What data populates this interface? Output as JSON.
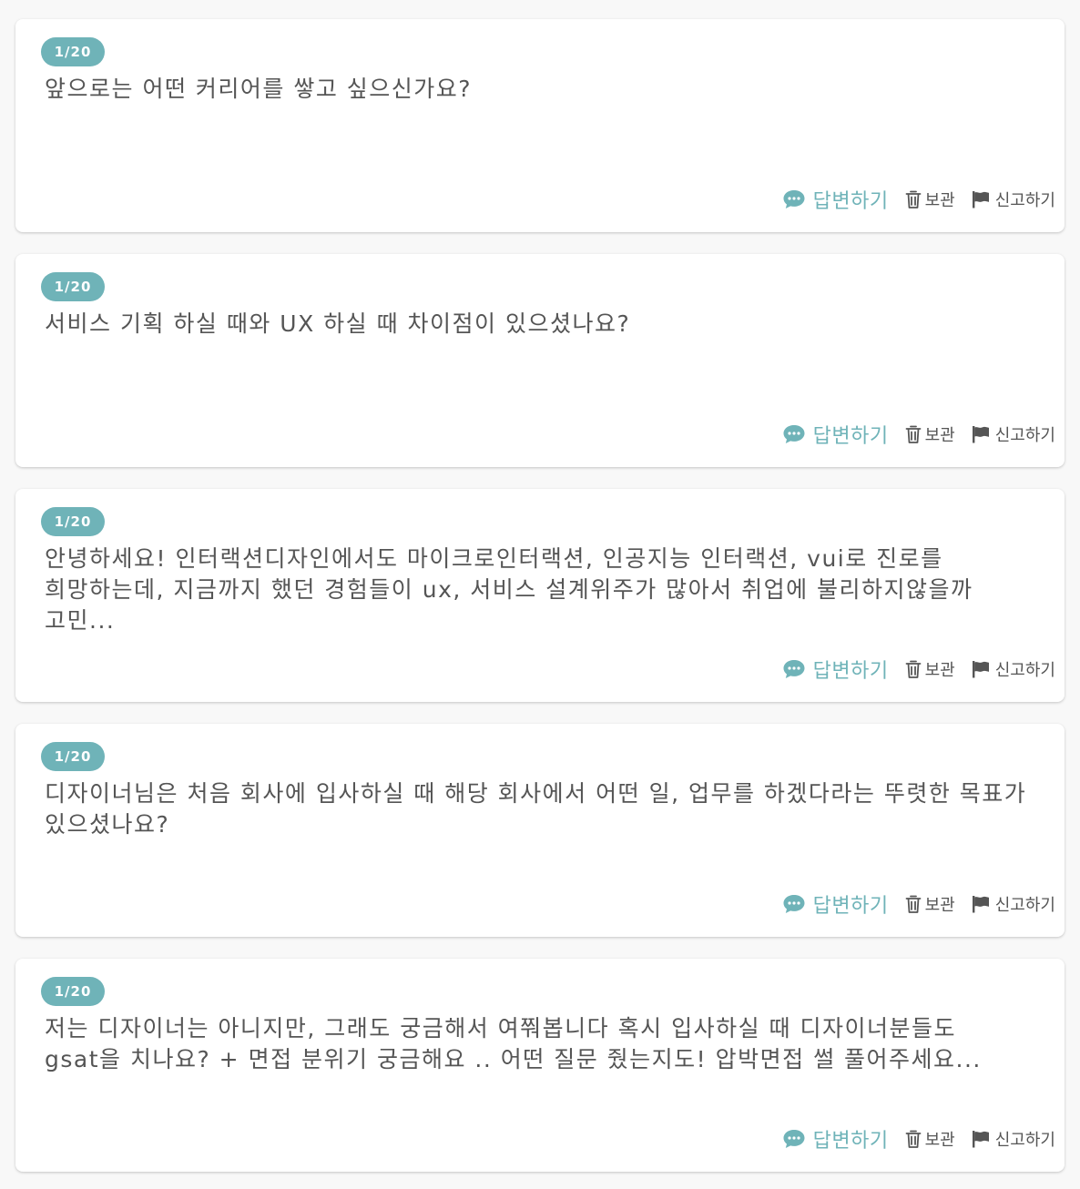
{
  "questions": [
    {
      "badge": "1/20",
      "text": "앞으로는 어떤 커리어를 쌓고 싶으신가요?",
      "actions": {
        "answer": "답변하기",
        "archive": "보관",
        "report": "신고하기"
      }
    },
    {
      "badge": "1/20",
      "text": "서비스 기획 하실 때와 UX 하실 때 차이점이 있으셨나요?",
      "actions": {
        "answer": "답변하기",
        "archive": "보관",
        "report": "신고하기"
      }
    },
    {
      "badge": "1/20",
      "text": "안녕하세요! 인터랙션디자인에서도 마이크로인터랙션, 인공지능 인터랙션, vui로 진로를 희망하는데, 지금까지 했던 경험들이 ux, 서비스 설계위주가 많아서 취업에 불리하지않을까 고민...",
      "actions": {
        "answer": "답변하기",
        "archive": "보관",
        "report": "신고하기"
      }
    },
    {
      "badge": "1/20",
      "text": "디자이너님은 처음 회사에 입사하실 때 해당 회사에서 어떤 일, 업무를 하겠다라는 뚜렷한 목표가 있으셨나요?",
      "actions": {
        "answer": "답변하기",
        "archive": "보관",
        "report": "신고하기"
      }
    },
    {
      "badge": "1/20",
      "text": "저는 디자이너는 아니지만, 그래도 궁금해서 여쭤봅니다 혹시 입사하실 때 디자이너분들도 gsat을 치나요? + 면접 분위기 궁금해요 .. 어떤 질문 줬는지도! 압박면접 썰 풀어주세요...",
      "actions": {
        "answer": "답변하기",
        "archive": "보관",
        "report": "신고하기"
      }
    }
  ],
  "icons": {
    "answer": "chat-bubble-icon",
    "archive": "trash-icon",
    "report": "flag-icon"
  },
  "colors": {
    "accent": "#6fb3b8",
    "text": "#555555",
    "card": "#ffffff",
    "background": "#f8f8f8"
  }
}
